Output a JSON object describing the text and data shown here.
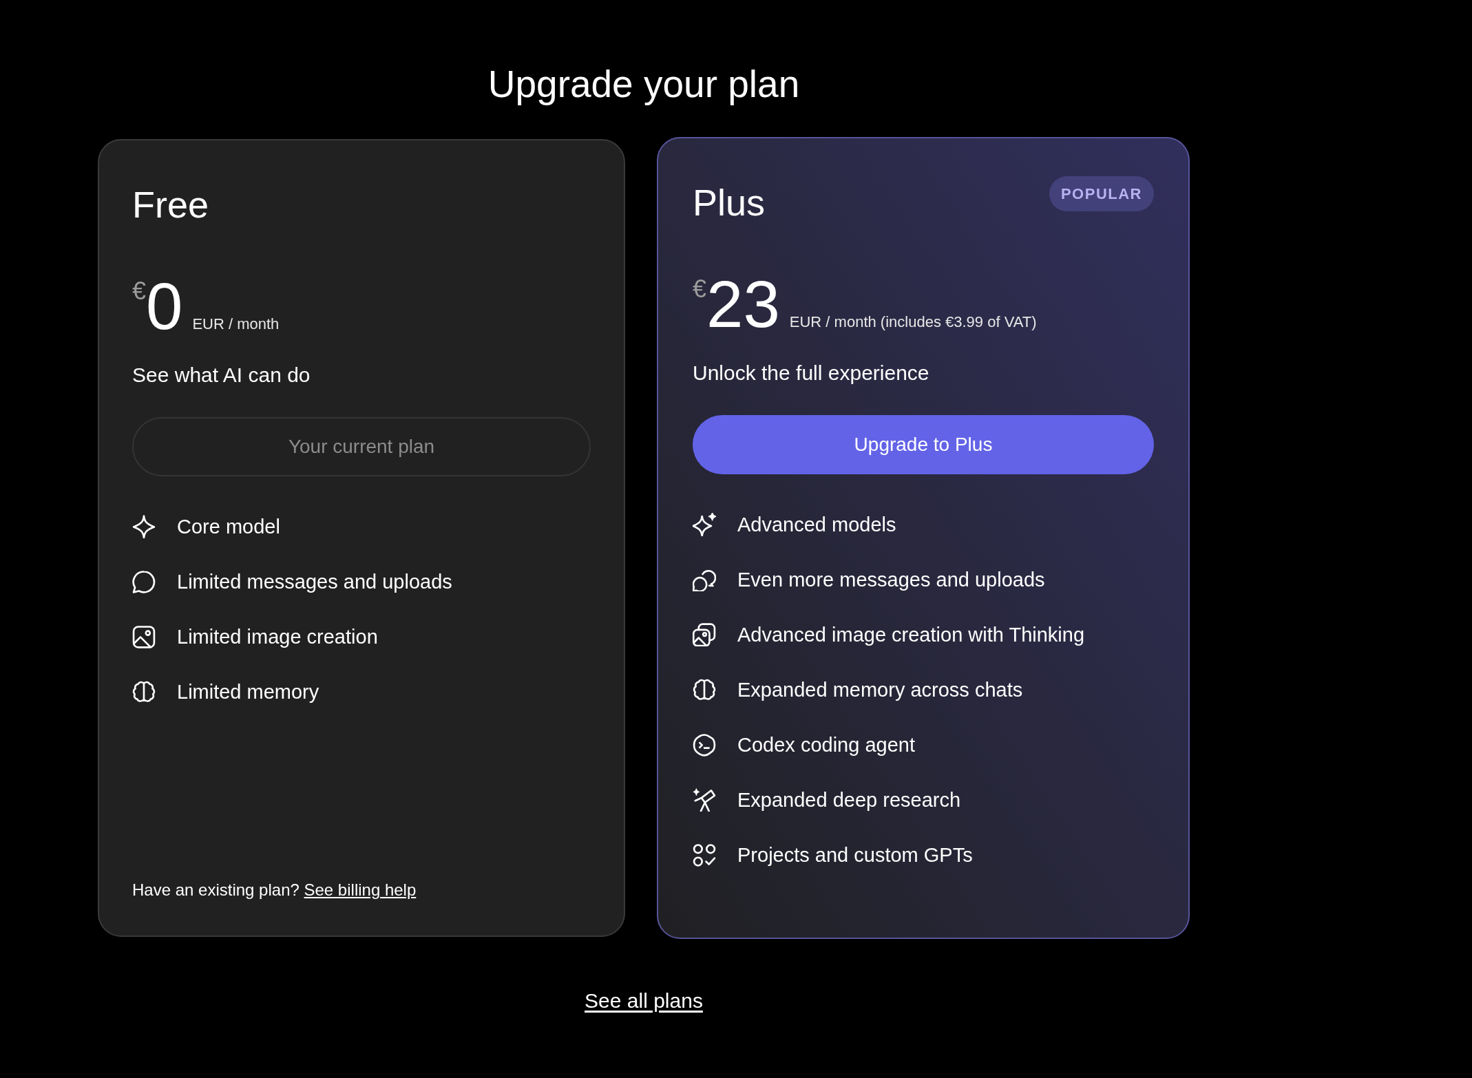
{
  "title": "Upgrade your plan",
  "plans": [
    {
      "name": "Free",
      "highlighted": false,
      "currency": "€",
      "price": "0",
      "period": "EUR / month",
      "tagline": "See what AI can do",
      "button": {
        "label": "Your current plan",
        "disabled": true
      },
      "features": [
        {
          "kind": "model",
          "text": "Core model"
        },
        {
          "kind": "messages",
          "text": "Limited messages and uploads"
        },
        {
          "kind": "images",
          "text": "Limited image creation"
        },
        {
          "kind": "memory",
          "text": "Limited memory"
        }
      ],
      "footer": {
        "text": "Have an existing plan?",
        "link": "See billing help"
      }
    },
    {
      "name": "Plus",
      "highlighted": true,
      "badge": "POPULAR",
      "currency": "€",
      "price": "23",
      "period": "EUR / month (includes €3.99 of VAT)",
      "tagline": "Unlock the full experience",
      "button": {
        "label": "Upgrade to Plus",
        "disabled": false
      },
      "features": [
        {
          "kind": "model",
          "text": "Advanced models"
        },
        {
          "kind": "messages",
          "text": "Even more messages and uploads"
        },
        {
          "kind": "images",
          "text": "Advanced image creation with Thinking"
        },
        {
          "kind": "memory",
          "text": "Expanded memory across chats"
        },
        {
          "kind": "coding",
          "text": "Codex coding agent"
        },
        {
          "kind": "research",
          "text": "Expanded deep research"
        },
        {
          "kind": "projects",
          "text": "Projects and custom GPTs"
        }
      ]
    }
  ],
  "see_all_link": "See all plans"
}
